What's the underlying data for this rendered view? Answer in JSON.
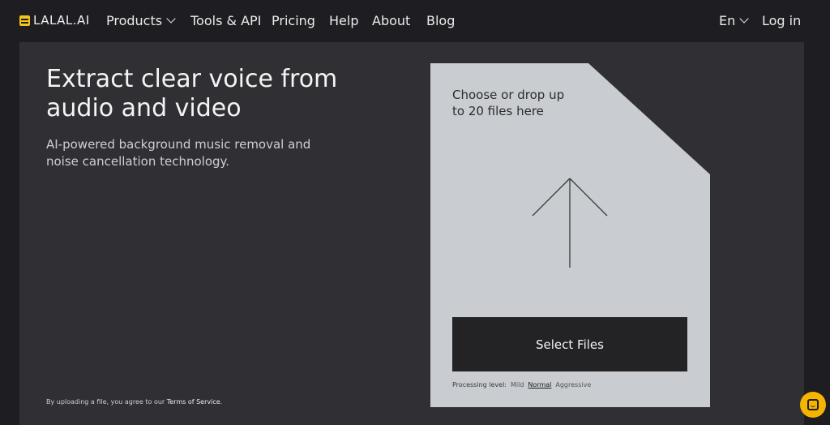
{
  "nav": {
    "logo_text": "LALAL.AI",
    "items": [
      {
        "label": "Products",
        "has_dropdown": true
      },
      {
        "label": "Tools & API"
      },
      {
        "label": "Pricing"
      },
      {
        "label": "Help"
      },
      {
        "label": "About"
      },
      {
        "label": "Blog"
      }
    ],
    "language": "En",
    "login": "Log in"
  },
  "hero": {
    "headline": "Extract clear voice from audio and video",
    "subtitle": "AI-powered background music removal and noise cancellation technology.",
    "terms_prefix": "By uploading a file, you agree to our ",
    "terms_link": "Terms of Service",
    "terms_suffix": "."
  },
  "upload": {
    "prompt": "Choose or drop up to 20 files here",
    "button": "Select Files",
    "processing_label": "Processing level:",
    "levels": [
      "Mild",
      "Normal",
      "Aggressive"
    ],
    "selected_level": "Normal"
  },
  "colors": {
    "accent": "#f5c518",
    "panel": "#302f33",
    "card": "#c9ccd0",
    "chat": "#f5b400"
  }
}
